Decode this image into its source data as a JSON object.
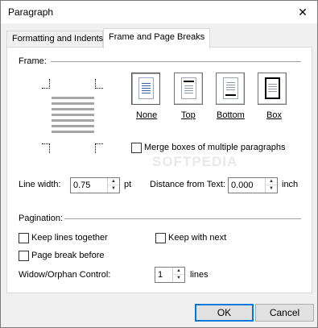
{
  "window": {
    "title": "Paragraph"
  },
  "tabs": [
    {
      "label": "Formatting and Indents",
      "active": false
    },
    {
      "label": "Frame and Page Breaks",
      "active": true
    }
  ],
  "frame": {
    "section_label": "Frame:",
    "options": [
      {
        "label": "None",
        "icon": "frame-none-icon",
        "selected": true
      },
      {
        "label": "Top",
        "icon": "frame-top-icon",
        "selected": false
      },
      {
        "label": "Bottom",
        "icon": "frame-bottom-icon",
        "selected": false
      },
      {
        "label": "Box",
        "icon": "frame-box-icon",
        "selected": false
      }
    ],
    "merge_label": "Merge boxes of multiple paragraphs",
    "merge_checked": false
  },
  "line_width": {
    "label": "Line width:",
    "value": "0.75",
    "unit": "pt"
  },
  "distance": {
    "label": "Distance from Text:",
    "value": "0.000",
    "unit": "inch"
  },
  "pagination": {
    "section_label": "Pagination:",
    "keep_lines_together": "Keep lines together",
    "keep_with_next": "Keep with next",
    "page_break_before": "Page break before",
    "widow_label": "Widow/Orphan Control:",
    "widow_value": "1",
    "widow_unit": "lines"
  },
  "buttons": {
    "ok": "OK",
    "cancel": "Cancel"
  },
  "watermark": "SOFTPEDIA"
}
